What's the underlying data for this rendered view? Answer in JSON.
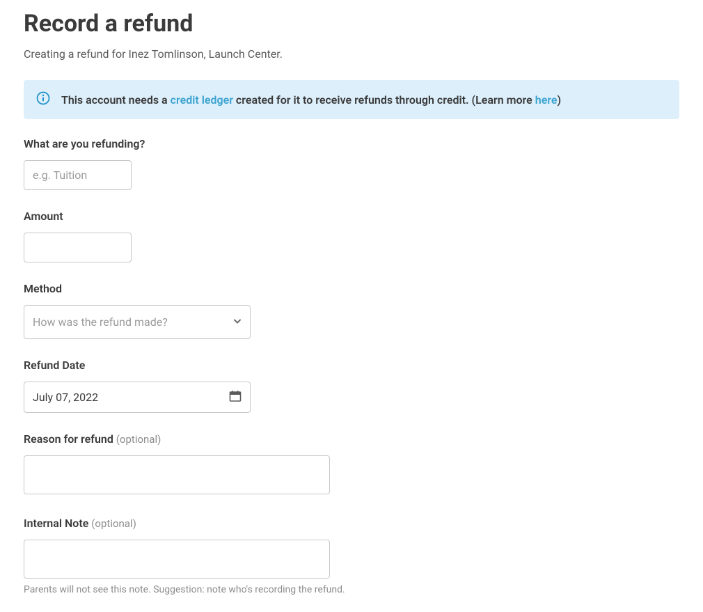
{
  "page_title": "Record a refund",
  "subtitle": "Creating a refund for Inez Tomlinson, Launch Center.",
  "banner": {
    "text_1": "This account needs a ",
    "link_1": "credit ledger",
    "text_2": " created for it to receive refunds through credit. (Learn more ",
    "link_2": "here",
    "text_3": ")"
  },
  "form": {
    "what_label": "What are you refunding?",
    "what_placeholder": "e.g. Tuition",
    "what_value": "",
    "amount_label": "Amount",
    "amount_value": "",
    "method_label": "Method",
    "method_placeholder": "How was the refund made?",
    "refund_date_label": "Refund Date",
    "refund_date_value": "July 07, 2022",
    "reason_label": "Reason for refund ",
    "reason_optional": "(optional)",
    "reason_value": "",
    "internal_note_label": "Internal Note ",
    "internal_note_optional": "(optional)",
    "internal_note_value": "",
    "internal_note_helper": "Parents will not see this note. Suggestion: note who's recording the refund."
  }
}
